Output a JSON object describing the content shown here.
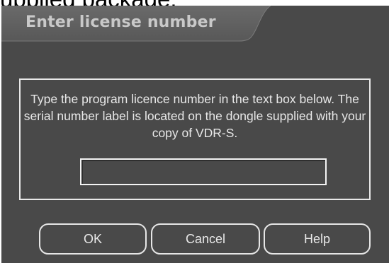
{
  "background": {
    "partial_text": "upplied package."
  },
  "dialog": {
    "title": "Enter license number",
    "instructions": "Type the program licence number in the text box below. The serial number label is located on the dongle supplied with your copy of VDR-S.",
    "license_input": {
      "value": "",
      "placeholder": ""
    },
    "buttons": {
      "ok": "OK",
      "cancel": "Cancel",
      "help": "Help"
    }
  },
  "colors": {
    "dialog_background": "#494949",
    "title_tab": "#5e5e5e",
    "title_text": "#c9c9c9",
    "text": "#e8e8e8",
    "border": "#e8e8e8"
  }
}
